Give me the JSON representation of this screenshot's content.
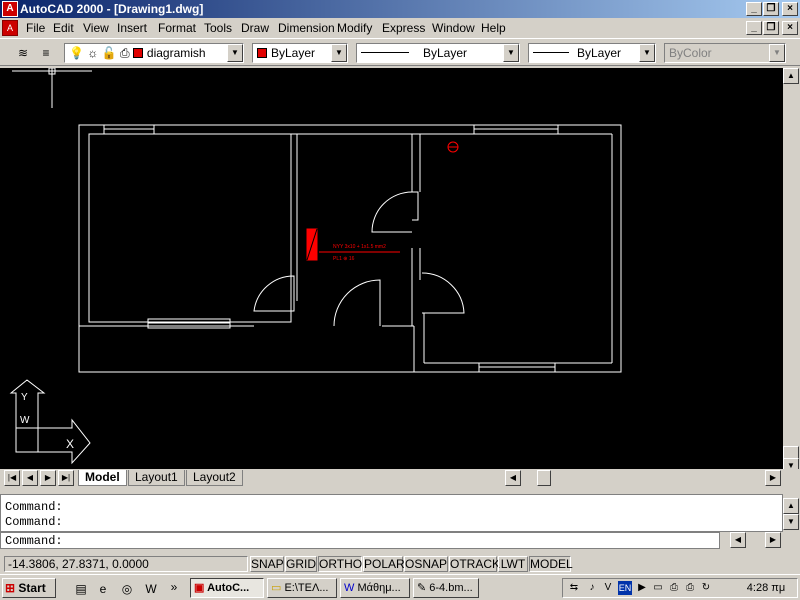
{
  "window": {
    "title": "AutoCAD 2000 - [Drawing1.dwg]",
    "app_icon": "autocad-icon"
  },
  "menu": [
    "File",
    "Edit",
    "View",
    "Insert",
    "Format",
    "Tools",
    "Draw",
    "Dimension",
    "Modify",
    "Express",
    "Window",
    "Help"
  ],
  "toolbar": {
    "layer": "diagramish",
    "color": "ByLayer",
    "linetype": "ByLayer",
    "lineweight": "ByLayer",
    "plotstyle": "ByColor",
    "layer_color": "#e00000"
  },
  "drawing": {
    "annotation_line1": "NYY 3x10 + 1x1.5 mm2",
    "annotation_line2": "PL1 ⊕ 16",
    "ucs_y": "Y",
    "ucs_w": "W",
    "ucs_x": "X",
    "line_color": "#ffffff",
    "annotation_color": "#ff0000"
  },
  "tabs": [
    "Model",
    "Layout1",
    "Layout2"
  ],
  "command": {
    "history": [
      "Command:",
      "Command:"
    ],
    "prompt": "Command:"
  },
  "status": {
    "coords": "-14.3806, 27.8371, 0.0000",
    "toggles": [
      "SNAP",
      "GRID",
      "ORTHO",
      "POLAR",
      "OSNAP",
      "OTRACK",
      "LWT",
      "MODEL"
    ]
  },
  "taskbar": {
    "start": "Start",
    "tasks": [
      "AutoC...",
      "E:\\ΤΕΛ...",
      "Μάθημ...",
      "6-4.bm..."
    ],
    "lang": "EN",
    "clock": "4:28 πμ"
  }
}
